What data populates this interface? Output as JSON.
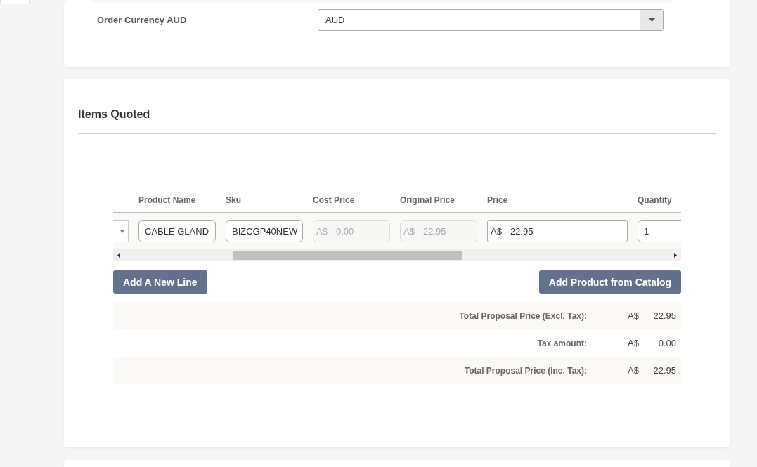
{
  "currency": {
    "label": "Order Currency AUD",
    "value": "AUD"
  },
  "items": {
    "title": "Items Quoted",
    "columns": [
      "Product Name",
      "Sku",
      "Cost Price",
      "Original Price",
      "Price",
      "Quantity"
    ],
    "row": [
      {
        "kind": "select"
      },
      {
        "kind": "text",
        "value": "CABLE GLAND",
        "disabled": false
      },
      {
        "kind": "text",
        "value": "BIZCGP40NEW",
        "disabled": false
      },
      {
        "kind": "money",
        "prefix": "A$",
        "value": "0.00",
        "disabled": true
      },
      {
        "kind": "money",
        "prefix": "A$",
        "value": "22.95",
        "disabled": true
      },
      {
        "kind": "money",
        "prefix": "A$",
        "value": "22.95",
        "disabled": false
      },
      {
        "kind": "text",
        "value": "1",
        "disabled": false
      }
    ],
    "buttons": [
      "Add A New Line",
      "Add Product from Catalog"
    ],
    "totals": [
      {
        "label": "Total Proposal Price (Excl. Tax):",
        "currency": "A$",
        "amount": "22.95"
      },
      {
        "label": "Tax amount:",
        "currency": "A$",
        "amount": "0.00"
      },
      {
        "label": "Total Proposal Price (Inc. Tax):",
        "currency": "A$",
        "amount": "22.95"
      }
    ]
  }
}
